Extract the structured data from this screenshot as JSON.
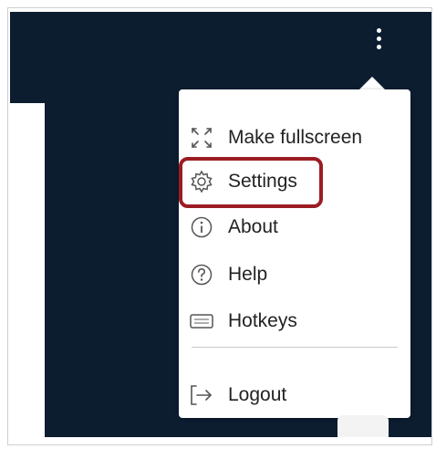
{
  "menu": {
    "items": [
      {
        "label": "Make fullscreen",
        "icon": "fullscreen-icon"
      },
      {
        "label": "Settings",
        "icon": "gear-icon"
      },
      {
        "label": "About",
        "icon": "info-icon"
      },
      {
        "label": "Help",
        "icon": "help-icon"
      },
      {
        "label": "Hotkeys",
        "icon": "keyboard-icon"
      }
    ],
    "logout": {
      "label": "Logout",
      "icon": "logout-icon"
    }
  },
  "colors": {
    "background": "#0c1d30",
    "highlight": "#9b1c23",
    "menu_text": "#222222"
  }
}
